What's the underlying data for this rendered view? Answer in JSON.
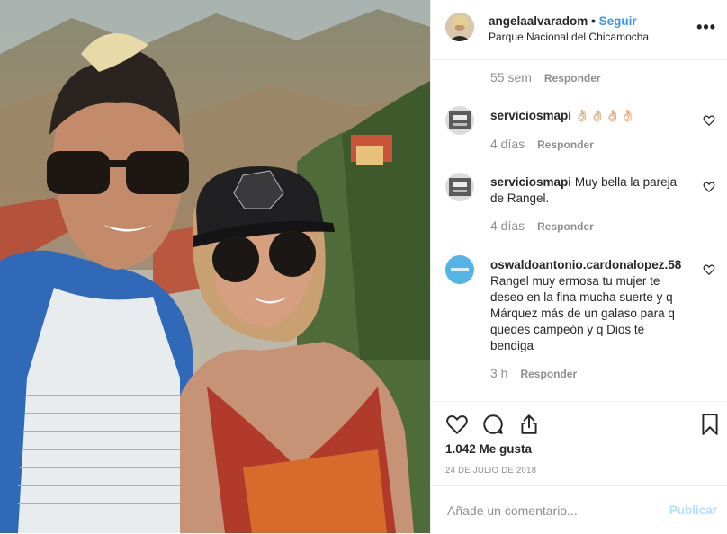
{
  "post": {
    "username": "angelaalvaradom",
    "separator": "•",
    "follow_label": "Seguir",
    "location": "Parque Nacional del Chicamocha",
    "more_label": "•••"
  },
  "comments": [
    {
      "user": "",
      "text": "",
      "time": "55 sem",
      "reply": "Responder"
    },
    {
      "user": "serviciosmapi",
      "text": "👌🏻👌🏻👌🏻👌🏻",
      "time": "4 días",
      "reply": "Responder"
    },
    {
      "user": "serviciosmapi",
      "text": "Muy bella la pareja de Rangel.",
      "time": "4 días",
      "reply": "Responder"
    },
    {
      "user": "oswaldoantonio.cardonalopez.58",
      "text": "Rangel muy ermosa tu mujer te deseo en la fina mucha suerte y q Márquez más de un galaso para q quedes campeón y q Dios te bendiga",
      "time": "3 h",
      "reply": "Responder"
    }
  ],
  "actions": {
    "likes": "1.042 Me gusta",
    "date": "24 DE JULIO DE 2018"
  },
  "add_comment": {
    "placeholder": "Añade un comentario...",
    "publish_label": "Publicar"
  },
  "colors": {
    "link": "#3897f0",
    "publish_disabled": "#b2dffc",
    "muted": "#8e8e8e"
  }
}
